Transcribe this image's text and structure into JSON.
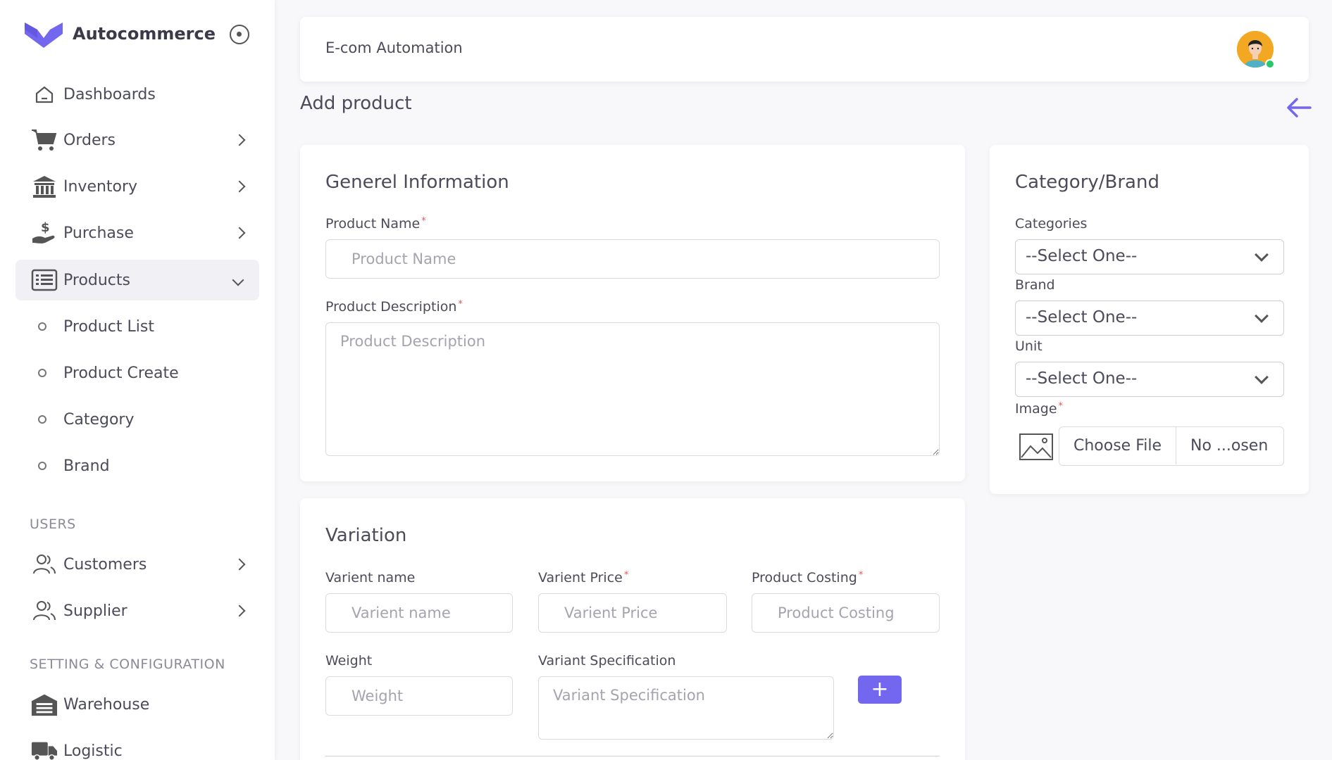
{
  "brand": {
    "name": "Autocommerce",
    "color": "#7367f0"
  },
  "sidebar": {
    "items": [
      {
        "label": "Dashboards",
        "icon": "home-icon"
      },
      {
        "label": "Orders",
        "icon": "cart-icon"
      },
      {
        "label": "Inventory",
        "icon": "bank-icon"
      },
      {
        "label": "Purchase",
        "icon": "hand-dollar-icon"
      },
      {
        "label": "Products",
        "icon": "list-icon",
        "active": true
      },
      {
        "label": "Product List"
      },
      {
        "label": "Product Create"
      },
      {
        "label": "Category"
      },
      {
        "label": "Brand"
      },
      {
        "label": "Customers",
        "icon": "users-icon"
      },
      {
        "label": "Supplier",
        "icon": "users-icon"
      },
      {
        "label": "Warehouse",
        "icon": "warehouse-icon"
      },
      {
        "label": "Logistic",
        "icon": "truck-icon"
      }
    ],
    "sections": {
      "users": "USERS",
      "settings": "SETTING & CONFIGURATION"
    }
  },
  "header": {
    "title": "E-com Automation"
  },
  "page": {
    "title": "Add product"
  },
  "general": {
    "title": "Generel Information",
    "product_name_label": "Product Name",
    "product_name_placeholder": "Product Name",
    "product_desc_label": "Product Description",
    "product_desc_placeholder": "Product Description"
  },
  "category": {
    "title": "Category/Brand",
    "categories_label": "Categories",
    "categories_value": "--Select One--",
    "brand_label": "Brand",
    "brand_value": "--Select One--",
    "unit_label": "Unit",
    "unit_value": "--Select One--",
    "image_label": "Image",
    "choose_file": "Choose File",
    "file_name": "No ...osen"
  },
  "variation": {
    "title": "Variation",
    "variant_name_label": "Varient name",
    "variant_name_placeholder": "Varient name",
    "variant_price_label": "Varient Price",
    "variant_price_placeholder": "Varient Price",
    "product_costing_label": "Product Costing",
    "product_costing_placeholder": "Product Costing",
    "weight_label": "Weight",
    "weight_placeholder": "Weight",
    "variant_spec_label": "Variant Specification",
    "variant_spec_placeholder": "Variant Specification",
    "add_label": "+"
  },
  "required_mark": "*"
}
